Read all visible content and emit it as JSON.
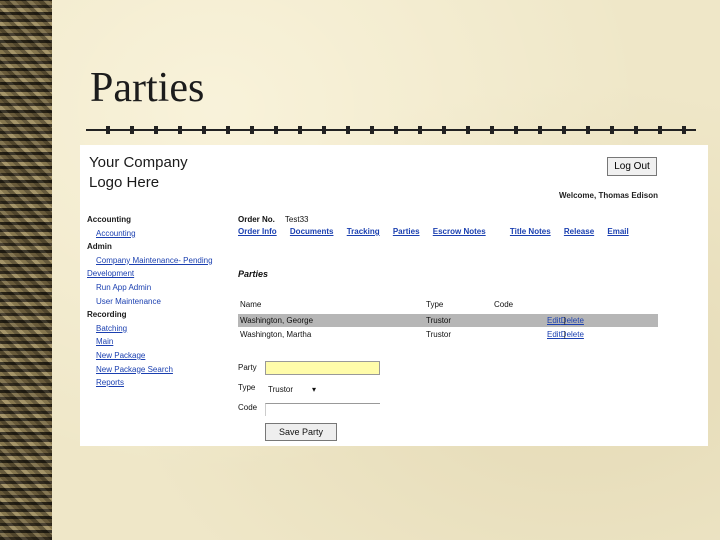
{
  "slide": {
    "title": "Parties"
  },
  "app": {
    "logo_line1": "Your Company",
    "logo_line2": "Logo Here",
    "logout_label": "Log Out",
    "welcome": "Welcome, Thomas Edison"
  },
  "nav": {
    "accounting_header": "Accounting",
    "accounting_link": "Accounting",
    "admin_header": "Admin",
    "company_maintenance": "Company Maintenance- Pending",
    "development": "Development",
    "run_app_admin": "Run App Admin",
    "user_maintenance": "User Maintenance",
    "recording_header": "Recording",
    "batching": "Batching",
    "main": "Main",
    "new_package": "New Package",
    "new_package_search": "New Package Search",
    "reports": "Reports"
  },
  "order": {
    "order_no_label": "Order No.",
    "order_no_value": "Test33"
  },
  "tabs": {
    "order_info": "Order Info",
    "documents": "Documents",
    "tracking": "Tracking",
    "parties": "Parties",
    "escrow_notes": "Escrow Notes",
    "title_notes": "Title Notes",
    "release": "Release",
    "email": "Email"
  },
  "section_title": "Parties",
  "table": {
    "headers": {
      "name": "Name",
      "type": "Type",
      "code": "Code"
    },
    "rows": [
      {
        "name": "Washington, George",
        "type": "Trustor",
        "code": "",
        "edit": "Edit",
        "delete": "Delete"
      },
      {
        "name": "Washington, Martha",
        "type": "Trustor",
        "code": "",
        "edit": "Edit",
        "delete": "Delete"
      }
    ]
  },
  "form": {
    "party_label": "Party",
    "party_value": "",
    "type_label": "Type",
    "type_value": "Trustor",
    "code_label": "Code",
    "code_value": "",
    "save_label": "Save Party"
  },
  "colors": {
    "link": "#1a3fb0",
    "selected_row": "#b6b6b6",
    "party_input_bg": "#fffcaa"
  }
}
